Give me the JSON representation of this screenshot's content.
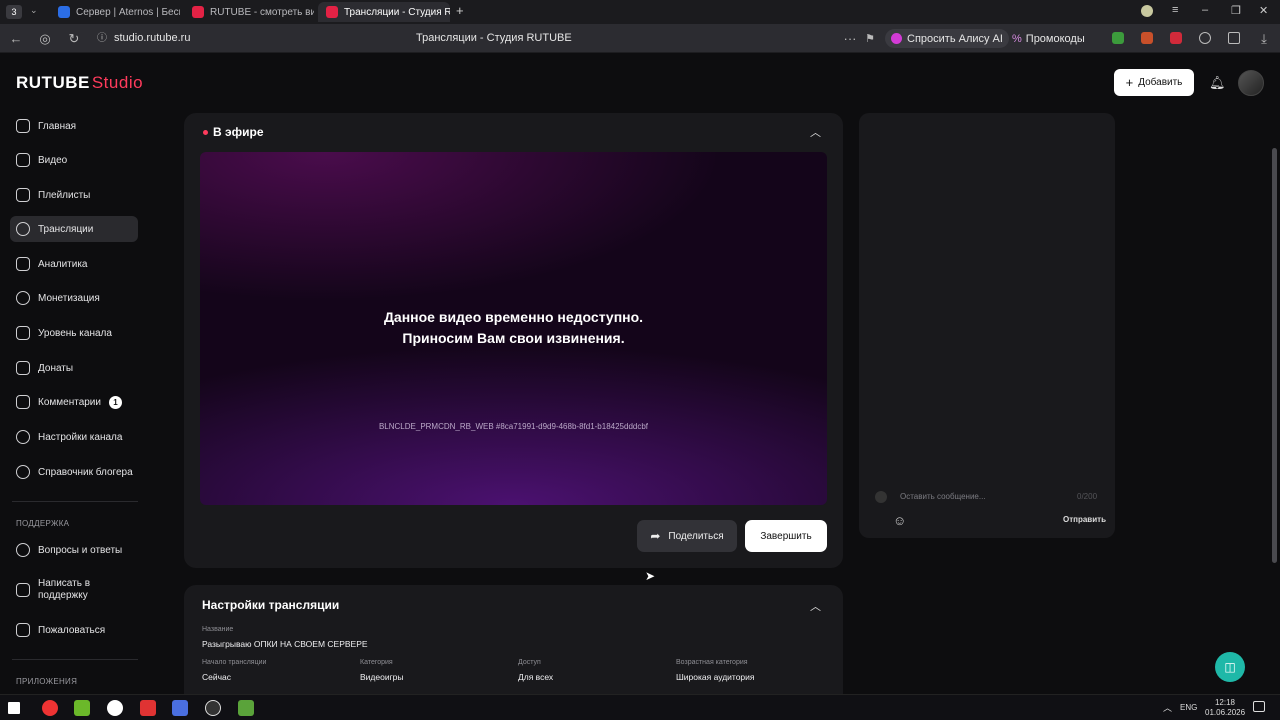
{
  "browser": {
    "tabs": [
      {
        "label": "Сервер | Aternos | Беспла",
        "color": "#2b6de5"
      },
      {
        "label": "RUTUBE - смотреть виде",
        "color": "#e32245"
      },
      {
        "label": "Трансляции - Студия R",
        "color": "#e32245"
      }
    ],
    "url": "studio.rutube.ru",
    "page_title": "Трансляции - Студия RUTUBE",
    "alice_label": "Спросить Алису AI",
    "promo_label": "Промокоды"
  },
  "header": {
    "logo_main": "RUTUBE",
    "logo_studio": "Studio",
    "add_label": "Добавить"
  },
  "sidebar": {
    "items": [
      {
        "label": "Главная"
      },
      {
        "label": "Видео"
      },
      {
        "label": "Плейлисты"
      },
      {
        "label": "Трансляции"
      },
      {
        "label": "Аналитика"
      },
      {
        "label": "Монетизация"
      },
      {
        "label": "Уровень канала"
      },
      {
        "label": "Донаты"
      },
      {
        "label": "Комментарии",
        "badge": "1"
      },
      {
        "label": "Настройки канала"
      },
      {
        "label": "Справочник блогера"
      }
    ],
    "support_heading": "ПОДДЕРЖКА",
    "support_items": [
      {
        "label": "Вопросы и ответы"
      },
      {
        "label": "Написать в поддержку"
      },
      {
        "label": "Пожаловаться"
      }
    ],
    "apps_heading": "ПРИЛОЖЕНИЯ"
  },
  "live": {
    "title": "В эфире",
    "message_line1": "Данное видео временно недоступно.",
    "message_line2": "Приносим Вам свои извинения.",
    "error_code": "BLNCLDE_PRMCDN_RB_WEB #8ca71991-d9d9-468b-8fd1-b18425dddcbf",
    "share_label": "Поделиться",
    "finish_label": "Завершить"
  },
  "chat": {
    "placeholder": "Оставить сообщение...",
    "counter": "0/200",
    "send_label": "Отправить"
  },
  "settings": {
    "title": "Настройки трансляции",
    "name_label": "Название",
    "name_value": "Разыгрываю ОПКИ НА СВОЕМ СЕРВЕРЕ",
    "fields": [
      {
        "label": "Начало трансляции",
        "value": "Сейчас"
      },
      {
        "label": "Категория",
        "value": "Видеоигры"
      },
      {
        "label": "Доступ",
        "value": "Для всех"
      },
      {
        "label": "Возрастная категория",
        "value": "Широкая аудитория"
      }
    ]
  },
  "taskbar": {
    "lang": "ENG",
    "time": "12:18",
    "date": "01.06.2026"
  }
}
